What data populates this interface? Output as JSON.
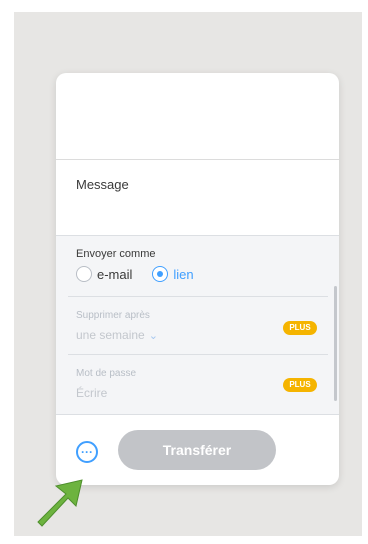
{
  "message": {
    "label": "Message"
  },
  "send_as": {
    "label": "Envoyer comme",
    "options": [
      {
        "label": "e-mail",
        "selected": false
      },
      {
        "label": "lien",
        "selected": true
      }
    ]
  },
  "delete_after": {
    "label": "Supprimer après",
    "value": "une semaine",
    "badge": "PLUS"
  },
  "password": {
    "label": "Mot de passe",
    "placeholder": "Écrire",
    "badge": "PLUS"
  },
  "footer": {
    "more_icon": "ellipsis-icon",
    "transfer_label": "Transférer"
  },
  "annotation": {
    "arrow_color": "#6db33f"
  },
  "colors": {
    "accent": "#409fff",
    "badge": "#f5b400",
    "button_disabled": "#c2c4c8"
  }
}
